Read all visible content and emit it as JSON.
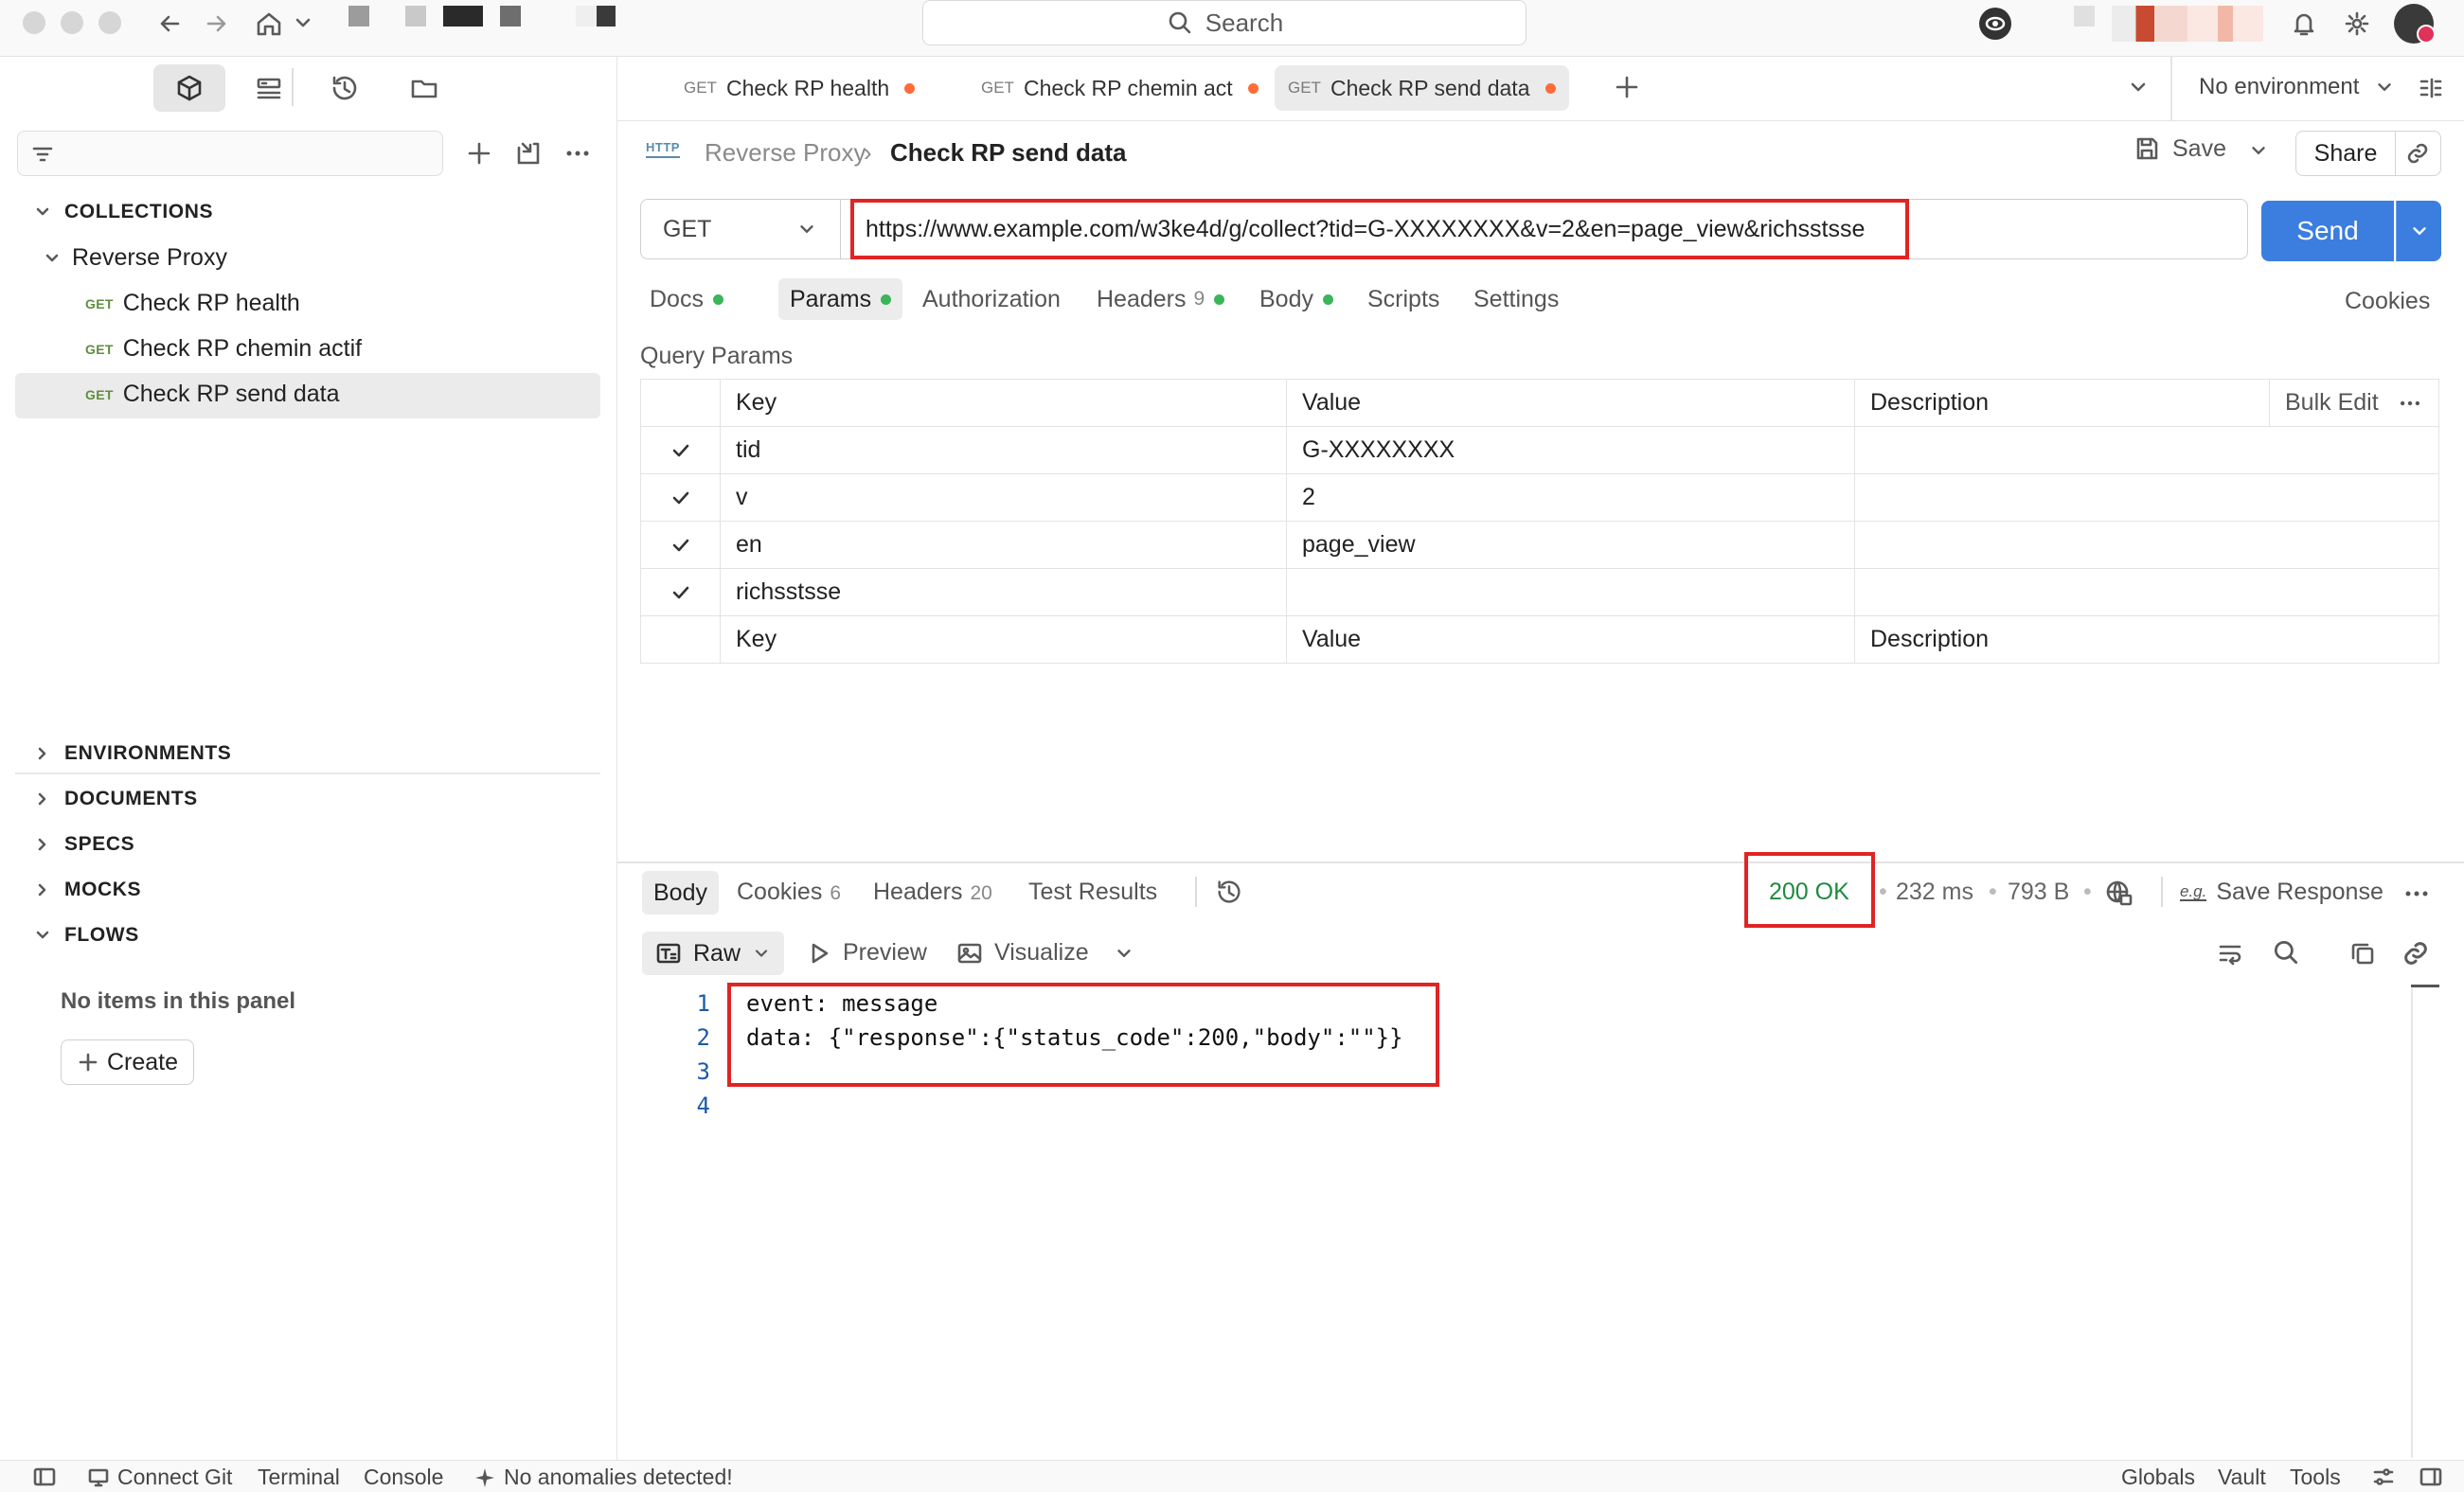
{
  "titlebar": {
    "search_label": "Search"
  },
  "sidebar": {
    "collections_label": "COLLECTIONS",
    "collection_name": "Reverse Proxy",
    "method_tag": "GET",
    "requests": [
      "Check RP health",
      "Check RP chemin actif",
      "Check RP send data"
    ],
    "sections": [
      "ENVIRONMENTS",
      "DOCUMENTS",
      "SPECS",
      "MOCKS",
      "FLOWS"
    ],
    "empty_text": "No items in this panel",
    "create_label": "Create"
  },
  "tabs": [
    {
      "method": "GET",
      "label": "Check RP health"
    },
    {
      "method": "GET",
      "label": "Check RP chemin act"
    },
    {
      "method": "GET",
      "label": "Check RP send data"
    }
  ],
  "environment_label": "No environment",
  "breadcrumb": {
    "http_badge": "HTTP",
    "parent": "Reverse Proxy",
    "current": "Check RP send data"
  },
  "actions": {
    "save": "Save",
    "share": "Share"
  },
  "request": {
    "method": "GET",
    "url": "https://www.example.com/w3ke4d/g/collect?tid=G-XXXXXXXX&v=2&en=page_view&richsstsse",
    "send_label": "Send"
  },
  "request_tabs": {
    "docs": "Docs",
    "params": "Params",
    "authorization": "Authorization",
    "headers": "Headers",
    "headers_count": "9",
    "body": "Body",
    "scripts": "Scripts",
    "settings": "Settings",
    "cookies": "Cookies"
  },
  "query_params": {
    "title": "Query Params",
    "headers": {
      "key": "Key",
      "value": "Value",
      "description": "Description",
      "bulk_edit": "Bulk Edit"
    },
    "rows": [
      {
        "key": "tid",
        "value": "G-XXXXXXXX"
      },
      {
        "key": "v",
        "value": "2"
      },
      {
        "key": "en",
        "value": "page_view"
      },
      {
        "key": "richsstsse",
        "value": ""
      }
    ],
    "placeholders": {
      "key": "Key",
      "value": "Value",
      "description": "Description"
    }
  },
  "response": {
    "tabs": {
      "body": "Body",
      "cookies": "Cookies",
      "cookies_count": "6",
      "headers": "Headers",
      "headers_count": "20",
      "tests": "Test Results"
    },
    "status": "200 OK",
    "time": "232 ms",
    "size": "793 B",
    "save_response": "Save Response",
    "format": "Raw",
    "preview": "Preview",
    "visualize": "Visualize",
    "lines": [
      "event: message",
      "data: {\"response\":{\"status_code\":200,\"body\":\"\"}}",
      "",
      ""
    ],
    "line_numbers": [
      "1",
      "2",
      "3",
      "4"
    ]
  },
  "statusbar": {
    "connect_git": "Connect Git",
    "terminal": "Terminal",
    "console": "Console",
    "anomalies": "No anomalies detected!",
    "globals": "Globals",
    "vault": "Vault",
    "tools": "Tools"
  },
  "colors": {
    "accent": "#ff6c37",
    "send_blue": "#3b7ee0",
    "status_green": "#1f8a3f",
    "highlight_red": "#e02424"
  }
}
